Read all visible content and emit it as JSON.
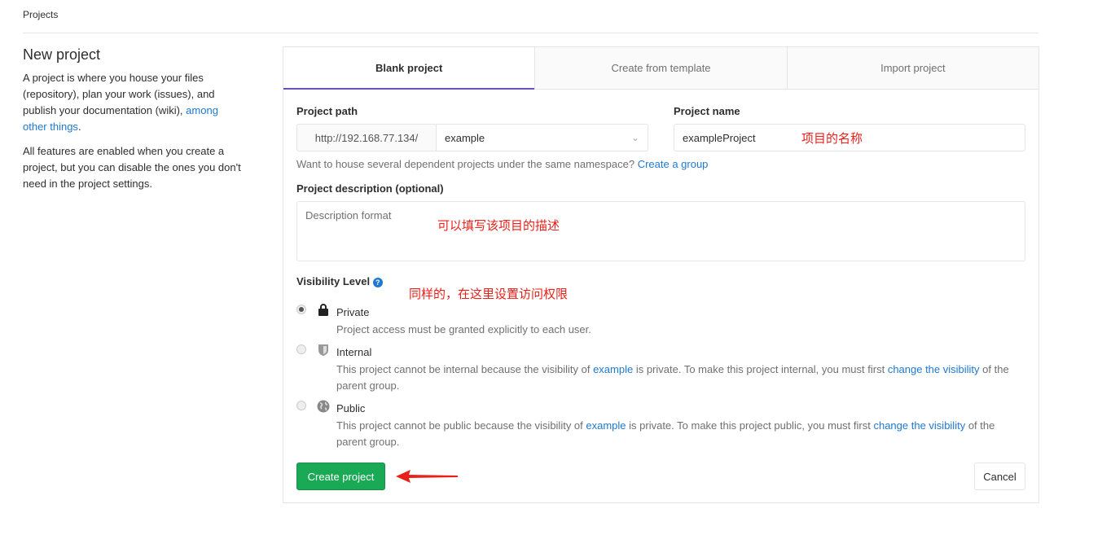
{
  "breadcrumb": "Projects",
  "left": {
    "title": "New project",
    "p1_a": "A project is where you house your files (repository), plan your work (issues), and publish your documentation (wiki),",
    "p1_link": "among other things",
    "p1_end": ".",
    "p2": "All features are enabled when you create a project, but you can disable the ones you don't need in the project settings."
  },
  "tabs": [
    {
      "label": "Blank project",
      "active": true
    },
    {
      "label": "Create from template"
    },
    {
      "label": "Import project"
    }
  ],
  "form": {
    "path_label": "Project path",
    "path_prefix": "http://192.168.77.134/",
    "namespace": "example",
    "name_label": "Project name",
    "name_value": "exampleProject",
    "group_hint": "Want to house several dependent projects under the same namespace?",
    "group_link": "Create a group",
    "desc_label": "Project description (optional)",
    "desc_placeholder": "Description format",
    "vis_label": "Visibility Level",
    "visibility": [
      {
        "title": "Private",
        "icon": "lock-icon",
        "selected": true,
        "desc": [
          "Project access must be granted explicitly to each user."
        ]
      },
      {
        "title": "Internal",
        "icon": "shield-icon",
        "selected": false,
        "desc": [
          "This project cannot be internal because the visibility of ",
          "example",
          " is private. To make this project internal, you must first ",
          "change the visibility",
          " of the parent group."
        ]
      },
      {
        "title": "Public",
        "icon": "globe-icon",
        "selected": false,
        "desc": [
          "This project cannot be public because the visibility of ",
          "example",
          " is private. To make this project public, you must first ",
          "change the visibility",
          " of the parent group."
        ]
      }
    ],
    "create": "Create project",
    "cancel": "Cancel"
  },
  "annotations": {
    "name": "项目的名称",
    "desc": "可以填写该项目的描述",
    "vis": "同样的，在这里设置访问权限"
  },
  "colors": {
    "accent": "#6b4fbb",
    "link": "#1f78d1",
    "create": "#1aaa55",
    "annotation": "#e8201a"
  }
}
